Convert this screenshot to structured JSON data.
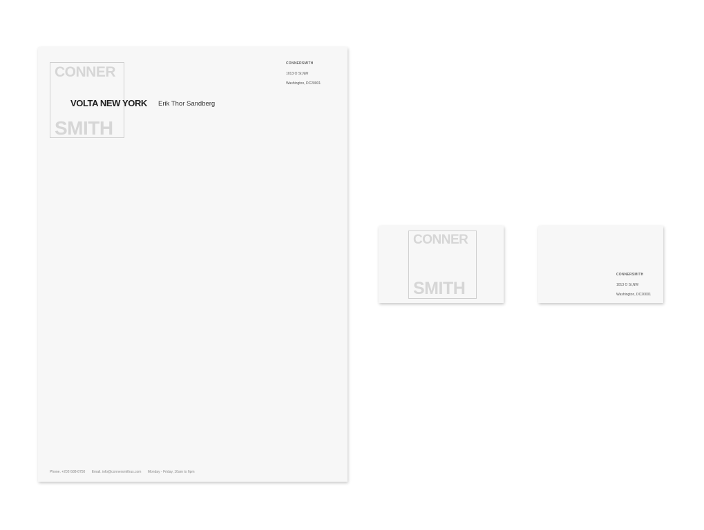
{
  "letterhead": {
    "logo": {
      "line1": "CONNER",
      "line2": "SMITH"
    },
    "client_name": "VOLTA NEW YORK",
    "recipient": "Erik Thor Sandberg",
    "address": {
      "name": "CONNERSMITH",
      "street": "1013 O St,NW",
      "city": "Washington, DC20001"
    },
    "footer": {
      "phone": "Phone. +202-588-8750",
      "email": "Email. info@connersmithus.com",
      "hours": "Monday - Friday, 10am to 6pm"
    }
  },
  "card_front": {
    "logo": {
      "line1": "CONNER",
      "line2": "SMITH"
    }
  },
  "card_back": {
    "address": {
      "name": "CONNERSMITH",
      "street": "1013 O St,NW",
      "city": "Washington, DC20001"
    }
  }
}
